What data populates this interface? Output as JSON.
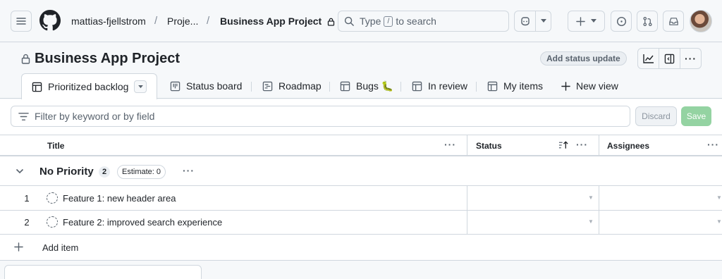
{
  "header": {
    "owner": "mattias-fjellstrom",
    "projects_crumb": "Proje...",
    "current_project": "Business App Project",
    "search_prefix": "Type",
    "search_slash": "/",
    "search_suffix": "to search"
  },
  "project": {
    "title": "Business App Project",
    "status_update_label": "Add status update"
  },
  "tabs": [
    {
      "label": "Prioritized backlog",
      "icon": "table-icon"
    },
    {
      "label": "Status board",
      "icon": "board-icon"
    },
    {
      "label": "Roadmap",
      "icon": "roadmap-icon"
    },
    {
      "label": "Bugs 🐛",
      "icon": "table-icon"
    },
    {
      "label": "In review",
      "icon": "table-icon"
    },
    {
      "label": "My items",
      "icon": "table-icon"
    },
    {
      "label": "New view",
      "icon": "plus-icon"
    }
  ],
  "filter": {
    "placeholder": "Filter by keyword or by field",
    "discard_label": "Discard",
    "save_label": "Save"
  },
  "table": {
    "columns": [
      "Title",
      "Status",
      "Assignees"
    ],
    "group": {
      "title": "No Priority",
      "count": "2",
      "estimate": "Estimate: 0"
    },
    "rows": [
      {
        "num": "1",
        "title": "Feature 1: new header area"
      },
      {
        "num": "2",
        "title": "Feature 2: improved search experience"
      }
    ],
    "add_item_label": "Add item"
  },
  "colors": {
    "accent_save": "#94d3a2",
    "border": "#d0d7de",
    "muted_text": "#59636e"
  }
}
